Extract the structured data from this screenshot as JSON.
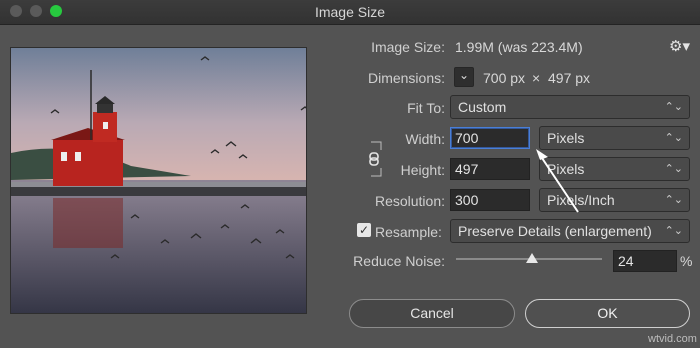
{
  "window": {
    "title": "Image Size"
  },
  "info": {
    "image_size_label": "Image Size:",
    "image_size_value": "1.99M (was 223.4M)",
    "dimensions_label": "Dimensions:",
    "dim_width": "700 px",
    "dim_sep": "×",
    "dim_height": "497 px"
  },
  "fit_to": {
    "label": "Fit To:",
    "value": "Custom"
  },
  "width": {
    "label": "Width:",
    "value": "700",
    "unit": "Pixels"
  },
  "height": {
    "label": "Height:",
    "value": "497",
    "unit": "Pixels"
  },
  "resolution": {
    "label": "Resolution:",
    "value": "300",
    "unit": "Pixels/Inch"
  },
  "resample": {
    "label": "Resample:",
    "checked": true,
    "method": "Preserve Details (enlargement)"
  },
  "reduce_noise": {
    "label": "Reduce Noise:",
    "value": "24",
    "unit": "%",
    "level": 0.52
  },
  "buttons": {
    "cancel": "Cancel",
    "ok": "OK"
  },
  "watermark": "wtvid.com",
  "icons": {
    "gear": "gear-icon",
    "link": "chain-link-icon",
    "check": "checkmark-icon",
    "chevron": "chevron-updown-icon"
  }
}
